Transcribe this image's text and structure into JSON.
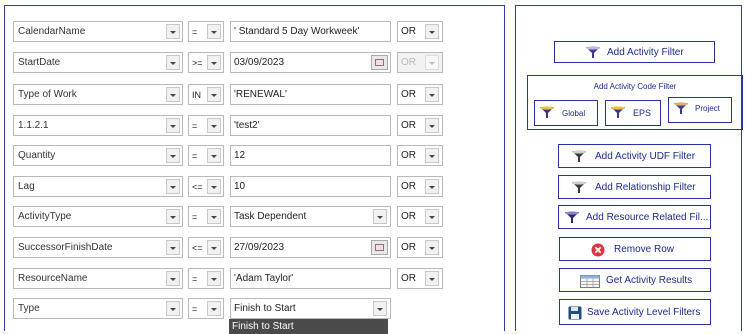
{
  "filter_rows": [
    {
      "field": "CalendarName",
      "operator": "=",
      "value": "' Standard 5 Day Workweek'",
      "value_type": "text",
      "logic": "OR",
      "logic_disabled": false
    },
    {
      "field": "StartDate",
      "operator": ">=",
      "value": "03/09/2023",
      "value_type": "date",
      "logic": "OR",
      "logic_disabled": true
    },
    {
      "field": "Type of Work",
      "operator": "IN",
      "value": "'RENEWAL'",
      "value_type": "text",
      "logic": "OR",
      "logic_disabled": false
    },
    {
      "field": "1.1.2.1",
      "operator": "=",
      "value": "'test2'",
      "value_type": "text",
      "logic": "OR",
      "logic_disabled": false
    },
    {
      "field": "Quantity",
      "operator": "=",
      "value": "12",
      "value_type": "text",
      "logic": "OR",
      "logic_disabled": false
    },
    {
      "field": "Lag",
      "operator": "<=",
      "value": "10",
      "value_type": "text",
      "logic": "OR",
      "logic_disabled": false
    },
    {
      "field": "ActivityType",
      "operator": "=",
      "value": "Task Dependent",
      "value_type": "select",
      "logic": "OR",
      "logic_disabled": false
    },
    {
      "field": "SuccessorFinishDate",
      "operator": "<=",
      "value": "27/09/2023",
      "value_type": "date",
      "logic": "OR",
      "logic_disabled": false
    },
    {
      "field": "ResourceName",
      "operator": "=",
      "value": "'Adam Taylor'",
      "value_type": "text",
      "logic": "OR",
      "logic_disabled": false
    },
    {
      "field": "Type",
      "operator": "=",
      "value": "Finish to Start",
      "value_type": "select",
      "logic": "",
      "logic_disabled": false
    }
  ],
  "open_dropdown": {
    "options": [
      "Finish to Start"
    ]
  },
  "buttons": {
    "add_activity_filter": "Add Activity Filter",
    "code_filter_group_title": "Add Activity Code Filter",
    "global": "Global",
    "eps": "EPS",
    "project": "Project",
    "add_udf_filter": "Add Activity UDF Filter",
    "add_relationship_filter": "Add Relationship Filter",
    "add_resource_filter": "Add Resource Related Fil...",
    "remove_row": "Remove Row",
    "get_results": "Get Activity Results",
    "save_filters": "Save Activity Level Filters"
  },
  "icons": {
    "filter": "funnel-icon",
    "remove": "remove-circle-icon",
    "results": "table-icon",
    "save": "floppy-disk-icon",
    "calendar": "calendar-icon"
  },
  "colors": {
    "accent_border": "#2534a3",
    "button_text": "#1b2a8c",
    "remove_red": "#d9353a",
    "dropdown_selected": "#4a4a4a"
  }
}
